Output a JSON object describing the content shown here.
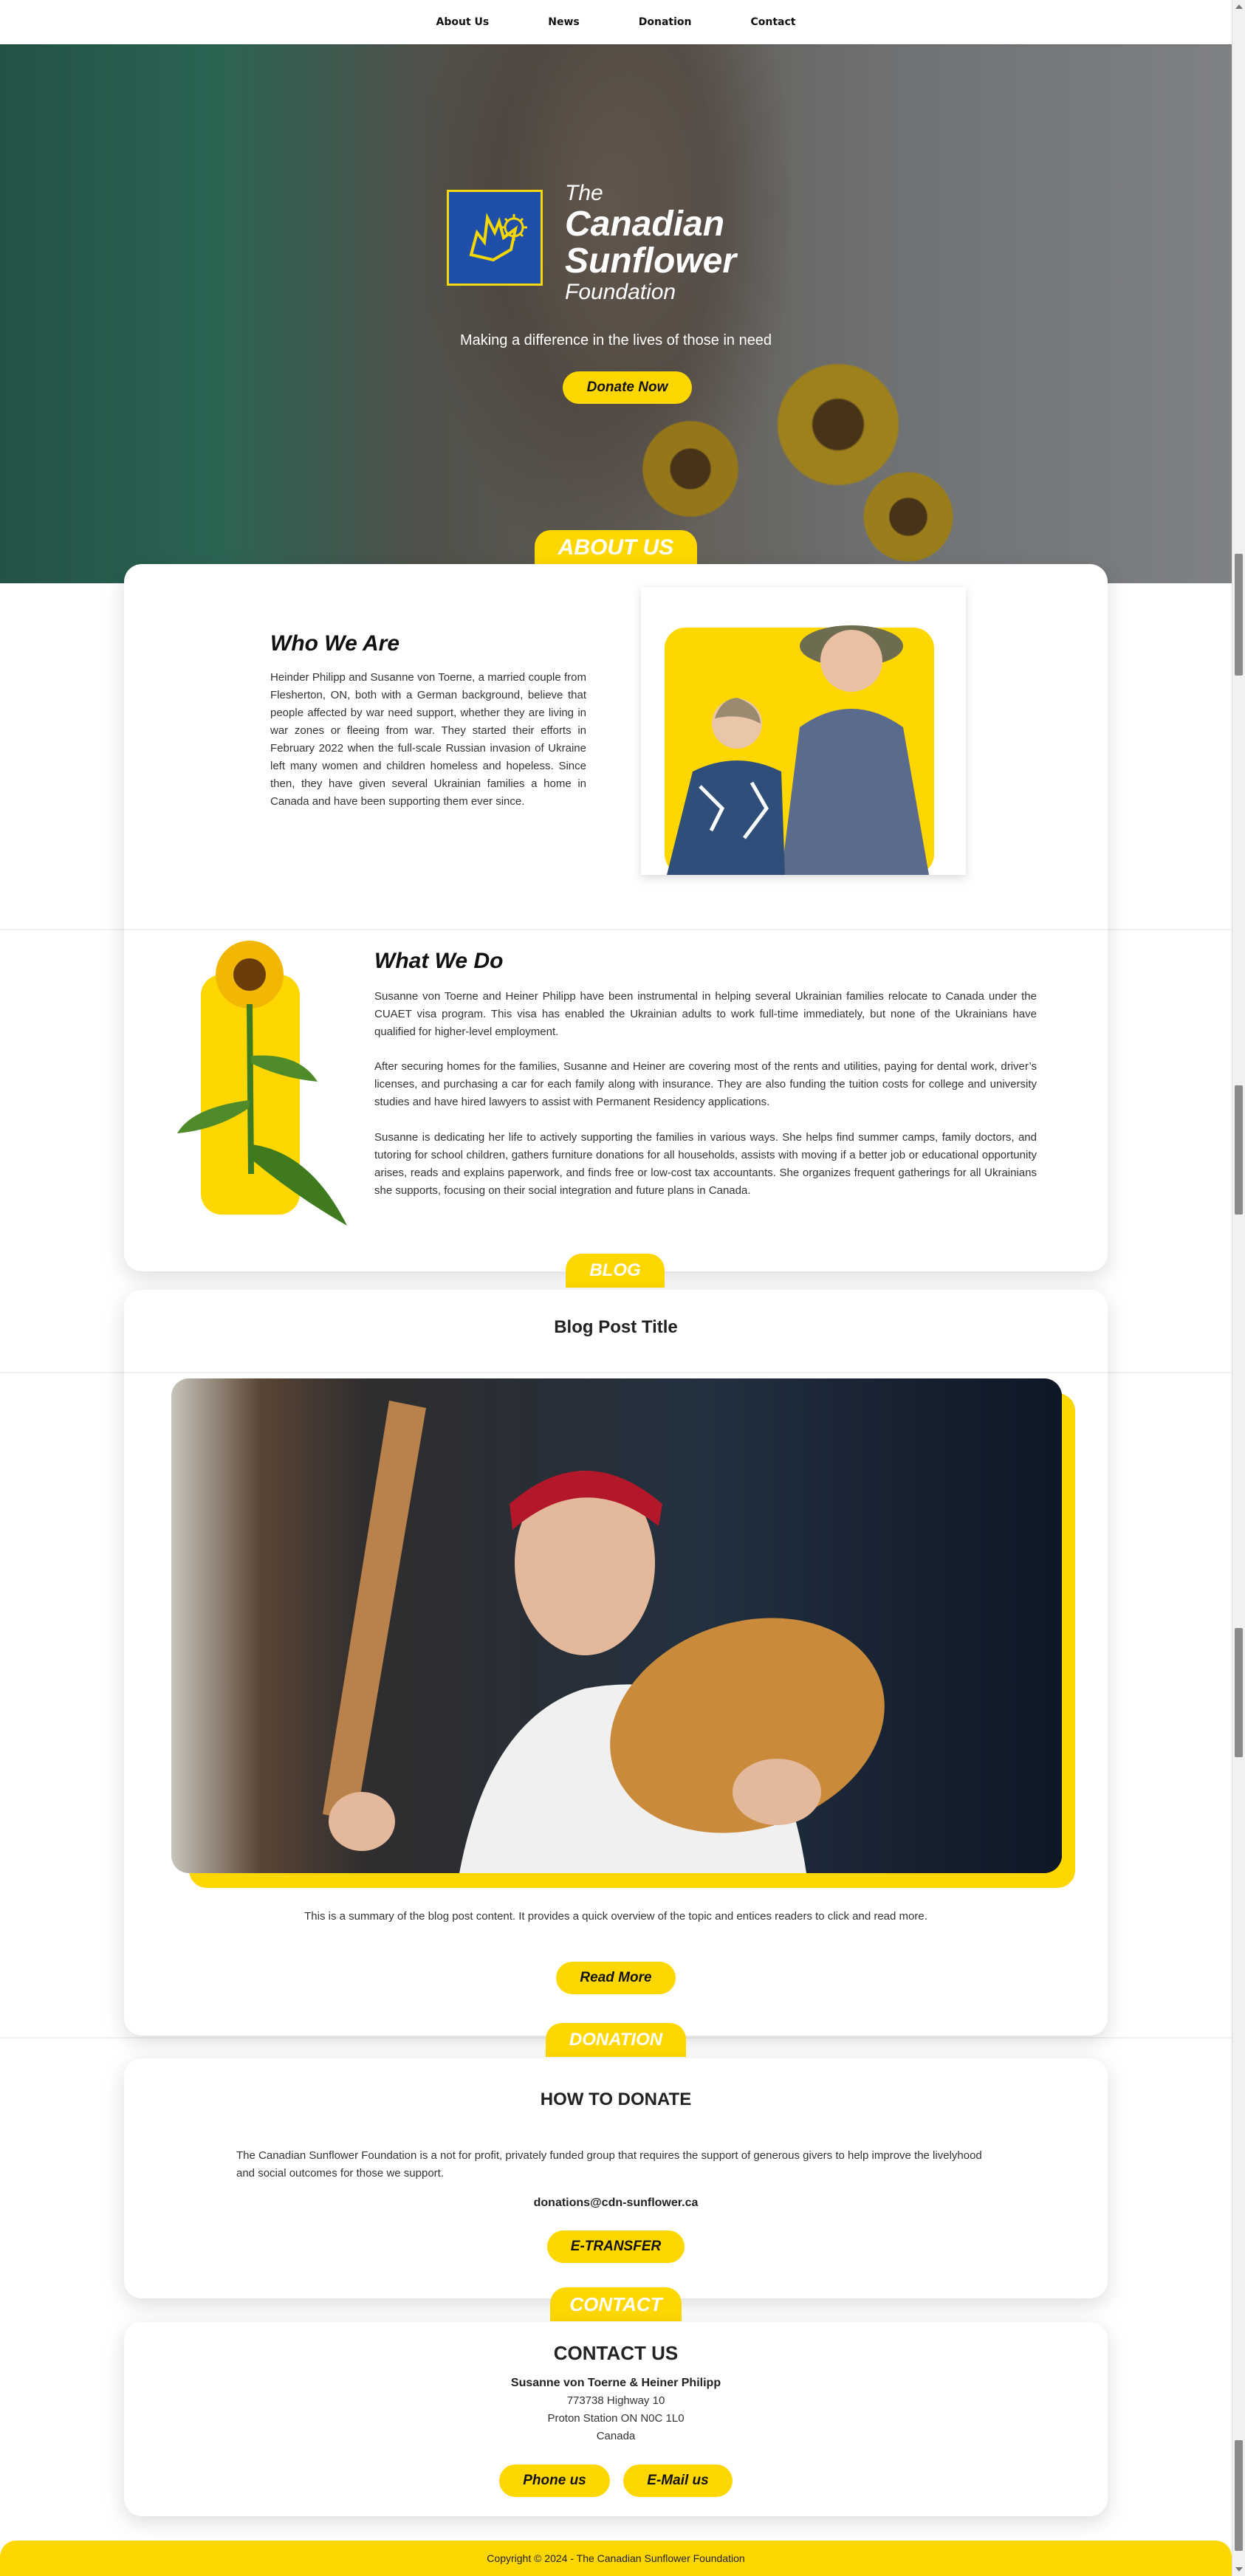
{
  "nav": {
    "items": [
      "About Us",
      "News",
      "Donation",
      "Contact"
    ]
  },
  "hero": {
    "logo_the": "The",
    "logo_canadian": "Canadian",
    "logo_sunflower": "Sunflower",
    "logo_foundation": "Foundation",
    "tagline": "Making a difference in the lives of those in need",
    "donate_button": "Donate Now"
  },
  "about": {
    "tab": "ABOUT US",
    "who_title": "Who We Are",
    "who_text": "Heinder Philipp and Susanne von Toerne, a married couple from Flesherton, ON, both with a German background, believe that people affected by war need support, whether they are living in war zones or fleeing from war. They started their efforts in February 2022 when the full-scale Russian invasion of Ukraine left many women and children homeless and hopeless. Since then, they have given several Ukrainian families a home in Canada and have been supporting them ever since.",
    "what_title": "What We Do",
    "what_p1": "Susanne von Toerne and Heiner Philipp have been instrumental in helping several Ukrainian families relocate to Canada under the CUAET visa program. This visa has enabled the Ukrainian adults to work full-time immediately, but none of the Ukrainians have qualified for higher-level employment.",
    "what_p2": "After securing homes for the families, Susanne and Heiner are covering most of the rents and utilities, paying for dental work, driver’s licenses, and purchasing a car for each family along with insurance. They are also funding the tuition costs for college and university studies and have hired lawyers to assist with Permanent Residency applications.",
    "what_p3": "Susanne is dedicating her life to actively supporting the families in various ways. She helps find summer camps, family doctors, and tutoring for school children, gathers furniture donations for all households, assists with moving if a better job or educational opportunity arises, reads and explains paperwork, and finds free or low-cost tax accountants. She organizes frequent gatherings for all Ukrainians she supports, focusing on their social integration and future plans in Canada."
  },
  "blog": {
    "tab": "BLOG",
    "post_title": "Blog Post Title",
    "summary": "This is a summary of the blog post content. It provides a quick overview of the topic and entices readers to click and read more.",
    "read_more": "Read More"
  },
  "donation": {
    "tab": "DONATION",
    "title": "HOW TO DONATE",
    "text": "The Canadian Sunflower Foundation is a not for profit, privately funded group that requires the support of generous givers to help improve the livelyhood and social outcomes for those we support.",
    "email": "donations@cdn-sunflower.ca",
    "etransfer": "E-TRANSFER"
  },
  "contact": {
    "tab": "CONTACT",
    "title": "CONTACT US",
    "names": "Susanne von Toerne & Heiner Philipp",
    "addr1": "773738 Highway 10",
    "addr2": "Proton Station ON N0C 1L0",
    "addr3": "Canada",
    "phone_button": "Phone us",
    "email_button": "E-Mail us"
  },
  "footer": {
    "copyright": "Copyright © 2024 - The Canadian Sunflower Foundation"
  },
  "colors": {
    "accent": "#ffd700",
    "logo_blue": "#1f4fa8"
  }
}
